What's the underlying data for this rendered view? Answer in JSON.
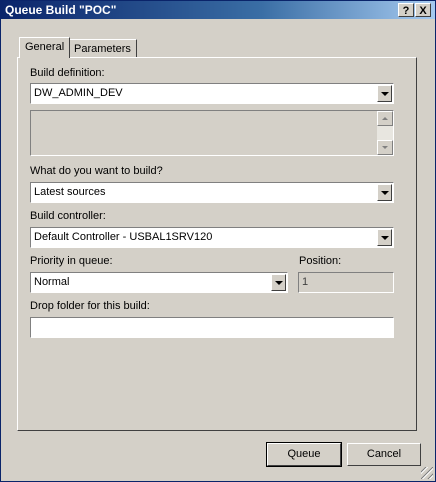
{
  "window": {
    "title": "Queue Build \"POC\"",
    "help_label": "?",
    "close_label": "X"
  },
  "tabs": [
    {
      "label": "General",
      "active": true
    },
    {
      "label": "Parameters",
      "active": false
    }
  ],
  "form": {
    "build_definition_label": "Build definition:",
    "build_definition_value": "DW_ADMIN_DEV",
    "what_to_build_label": "What do you want to build?",
    "what_to_build_value": "Latest sources",
    "build_controller_label": "Build controller:",
    "build_controller_value": "Default Controller - USBAL1SRV120",
    "priority_label": "Priority in queue:",
    "priority_value": "Normal",
    "position_label": "Position:",
    "position_value": "1",
    "drop_folder_label": "Drop folder for this build:",
    "drop_folder_value": ""
  },
  "buttons": {
    "queue_label": "Queue",
    "cancel_label": "Cancel"
  }
}
